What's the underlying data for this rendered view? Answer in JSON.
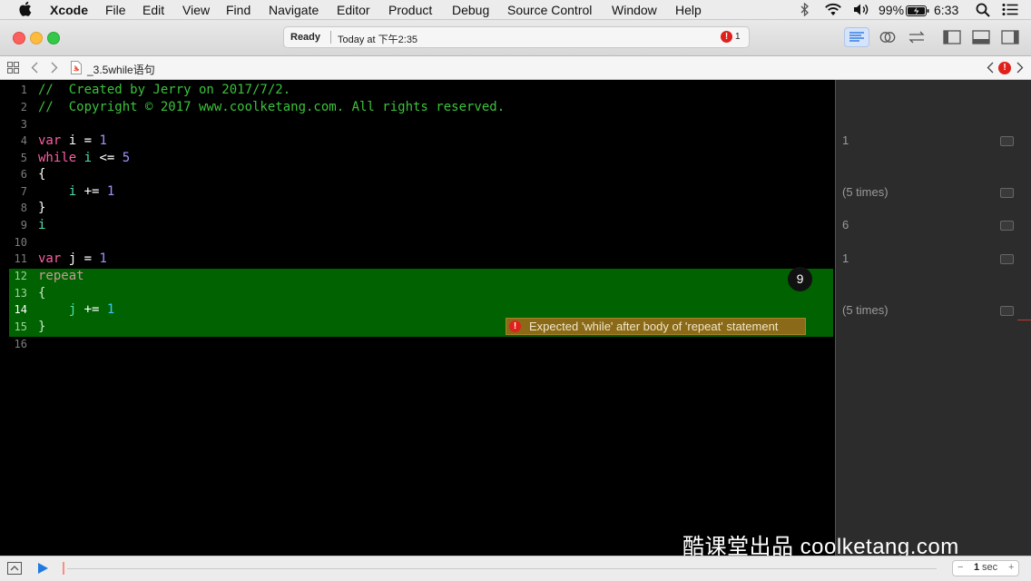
{
  "menubar": {
    "app_name": "Xcode",
    "items": [
      "File",
      "Edit",
      "View",
      "Find",
      "Navigate",
      "Editor",
      "Product",
      "Debug",
      "Source Control",
      "Window",
      "Help"
    ],
    "battery": "99%",
    "time": "6:33"
  },
  "toolbar": {
    "status": "Ready",
    "timestamp": "Today at 下午2:35",
    "error_count": "1"
  },
  "jumpbar": {
    "file_name": "_3.5while语句"
  },
  "editor": {
    "lines": [
      {
        "num": "1",
        "text": "//  Created by Jerry on 2017/7/2."
      },
      {
        "num": "2",
        "text": "//  Copyright © 2017 www.coolketang.com. All rights reserved."
      },
      {
        "num": "3",
        "text": ""
      },
      {
        "num": "4",
        "text": "var i = 1"
      },
      {
        "num": "5",
        "text": "while i <= 5"
      },
      {
        "num": "6",
        "text": "{"
      },
      {
        "num": "7",
        "text": "    i += 1"
      },
      {
        "num": "8",
        "text": "}"
      },
      {
        "num": "9",
        "text": "i"
      },
      {
        "num": "10",
        "text": ""
      },
      {
        "num": "11",
        "text": "var j = 1"
      },
      {
        "num": "12",
        "text": "repeat"
      },
      {
        "num": "13",
        "text": "{"
      },
      {
        "num": "14",
        "text": "    j += 1"
      },
      {
        "num": "15",
        "text": "}"
      },
      {
        "num": "16",
        "text": ""
      }
    ],
    "error_message": "Expected 'while' after body of 'repeat' statement",
    "badge_value": "9"
  },
  "results": [
    "1",
    "(5 times)",
    "6",
    "1",
    "(5 times)"
  ],
  "bottombar": {
    "stepper_minus": "−",
    "duration_value": "1",
    "duration_unit": "sec",
    "stepper_plus": "+"
  },
  "watermark": "酷课堂出品 coolketang.com",
  "colors": {
    "highlight": "#006200",
    "keyword": "#fc5fa3",
    "number": "#a393ff",
    "comment": "#3bc23b",
    "identifier": "#52e0a8",
    "error": "#e0201a",
    "error_banner": "#8a6a18"
  }
}
